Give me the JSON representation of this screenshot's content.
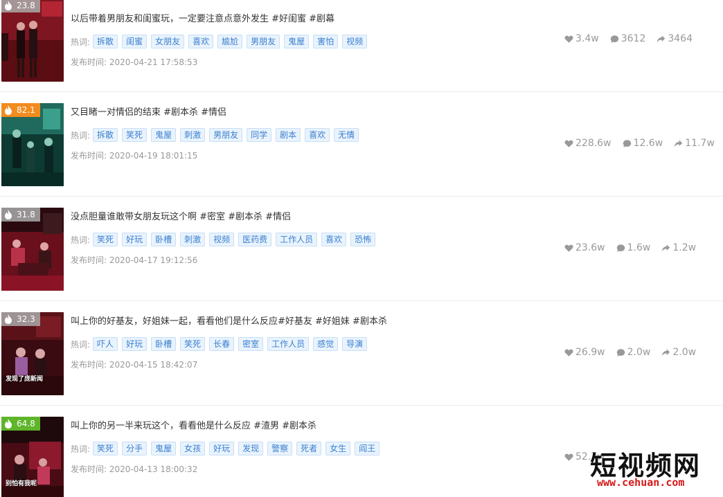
{
  "tags_label": "热词:",
  "date_label": "发布时间:",
  "items": [
    {
      "heat": "23.8",
      "heat_color": "gray",
      "title": "以后带着男朋友和闺蜜玩，一定要注意点意外发生 #好闺蜜 #剧幕",
      "tags": [
        "拆散",
        "闺蜜",
        "女朋友",
        "喜欢",
        "尴尬",
        "男朋友",
        "鬼屋",
        "害怕",
        "视频"
      ],
      "date": "2020-04-21 17:58:53",
      "likes": "3.4w",
      "comments": "3612",
      "shares": "3464",
      "thumb_caption": ""
    },
    {
      "heat": "82.1",
      "heat_color": "orange",
      "title": "又目睹一对情侣的结束 #剧本杀 #情侣",
      "tags": [
        "拆散",
        "笑死",
        "鬼屋",
        "刺激",
        "男朋友",
        "同学",
        "剧本",
        "喜欢",
        "无情"
      ],
      "date": "2020-04-19 18:01:15",
      "likes": "228.6w",
      "comments": "12.6w",
      "shares": "11.7w",
      "thumb_caption": ""
    },
    {
      "heat": "31.8",
      "heat_color": "gray",
      "title": "没点胆量谁敢带女朋友玩这个啊 #密室 #剧本杀 #情侣",
      "tags": [
        "笑死",
        "好玩",
        "卧槽",
        "刺激",
        "视频",
        "医药费",
        "工作人员",
        "喜欢",
        "恐怖"
      ],
      "date": "2020-04-17 19:12:56",
      "likes": "23.6w",
      "comments": "1.6w",
      "shares": "1.2w",
      "thumb_caption": ""
    },
    {
      "heat": "32.3",
      "heat_color": "gray",
      "title": "叫上你的好基友，好姐妹一起，看看他们是什么反应#好基友 #好姐妹 #剧本杀",
      "tags": [
        "吓人",
        "好玩",
        "卧槽",
        "笑死",
        "长春",
        "密室",
        "工作人员",
        "感觉",
        "导演"
      ],
      "date": "2020-04-15 18:42:07",
      "likes": "26.9w",
      "comments": "2.0w",
      "shares": "2.0w",
      "thumb_caption": "发现了庞新闻"
    },
    {
      "heat": "64.8",
      "heat_color": "green",
      "title": "叫上你的另一半来玩这个，看看他是什么反应 #渣男 #剧本杀",
      "tags": [
        "笑死",
        "分手",
        "鬼屋",
        "女孩",
        "好玩",
        "发现",
        "警察",
        "死者",
        "女生",
        "阎王"
      ],
      "date": "2020-04-13 18:00:32",
      "likes": "52.7w",
      "comments": "",
      "shares": "",
      "thumb_caption": "别怕有我呢"
    }
  ],
  "watermark": {
    "text": "短视频网",
    "url": "www.cehuan.com"
  }
}
